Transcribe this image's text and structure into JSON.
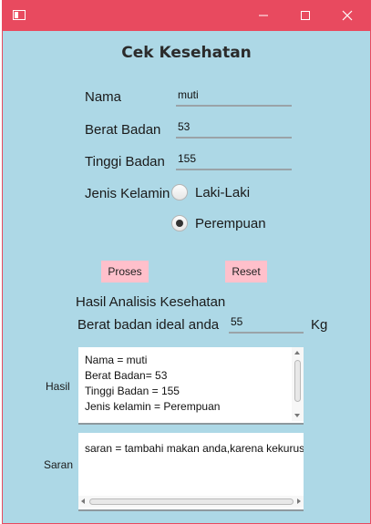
{
  "title": "Cek Kesehatan",
  "labels": {
    "nama": "Nama",
    "berat": "Berat Badan",
    "tinggi": "Tinggi Badan",
    "jenis": "Jenis Kelamin"
  },
  "inputs": {
    "nama": "muti",
    "berat": "53",
    "tinggi": "155"
  },
  "gender_options": [
    {
      "label": "Laki-Laki",
      "selected": false
    },
    {
      "label": "Perempuan",
      "selected": true
    }
  ],
  "buttons": {
    "proses": "Proses",
    "reset": "Reset"
  },
  "hasil_heading": "Hasil Analisis Kesehatan",
  "ideal": {
    "label": "Berat badan ideal anda",
    "value": "55",
    "unit": "Kg"
  },
  "hasil": {
    "label": "Hasil",
    "lines": [
      "Nama = muti",
      "Berat Badan= 53",
      "Tinggi Badan = 155",
      "Jenis kelamin = Perempuan"
    ]
  },
  "saran": {
    "label": "Saran",
    "text": "saran = tambahi makan anda,karena kekurusan"
  },
  "colors": {
    "titlebar": "#e84a5f",
    "background": "#add8e6",
    "button": "#ffc0cb"
  },
  "icons": {
    "app": "app-icon",
    "minimize": "minimize-icon",
    "maximize": "maximize-icon",
    "close": "close-icon"
  }
}
